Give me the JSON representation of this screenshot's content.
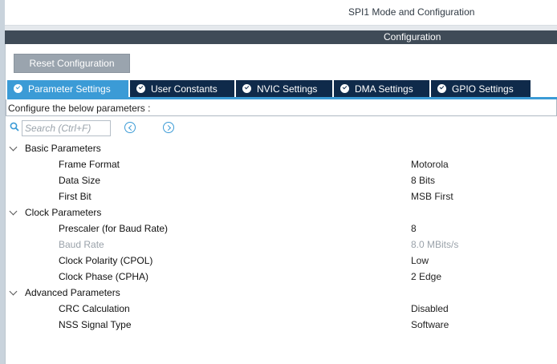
{
  "header": {
    "mode_title": "SPI1 Mode and Configuration",
    "config_title": "Configuration"
  },
  "toolbar": {
    "reset_label": "Reset Configuration"
  },
  "tabs": [
    {
      "label": "Parameter Settings",
      "active": true
    },
    {
      "label": "User Constants",
      "active": false
    },
    {
      "label": "NVIC Settings",
      "active": false
    },
    {
      "label": "DMA Settings",
      "active": false
    },
    {
      "label": "GPIO Settings",
      "active": false
    }
  ],
  "configure_text": "Configure the below parameters :",
  "search": {
    "placeholder": "Search (Ctrl+F)",
    "icons": [
      "search-icon",
      "previous-icon",
      "next-icon"
    ]
  },
  "groups": [
    {
      "label": "Basic Parameters",
      "params": [
        {
          "name": "Frame Format",
          "value": "Motorola"
        },
        {
          "name": "Data Size",
          "value": "8 Bits"
        },
        {
          "name": "First Bit",
          "value": "MSB First"
        }
      ]
    },
    {
      "label": "Clock Parameters",
      "params": [
        {
          "name": "Prescaler (for Baud Rate)",
          "value": "8"
        },
        {
          "name": "Baud Rate",
          "value": "8.0 MBits/s",
          "disabled": true
        },
        {
          "name": "Clock Polarity (CPOL)",
          "value": "Low"
        },
        {
          "name": "Clock Phase (CPHA)",
          "value": "2 Edge"
        }
      ]
    },
    {
      "label": "Advanced Parameters",
      "params": [
        {
          "name": "CRC Calculation",
          "value": "Disabled"
        },
        {
          "name": "NSS Signal Type",
          "value": "Software"
        }
      ]
    }
  ],
  "colors": {
    "tab_active": "#3b9bd6",
    "tab_inactive": "#0f2a4a",
    "config_bar": "#3f4b57",
    "reset_button": "#9aa4ae"
  }
}
